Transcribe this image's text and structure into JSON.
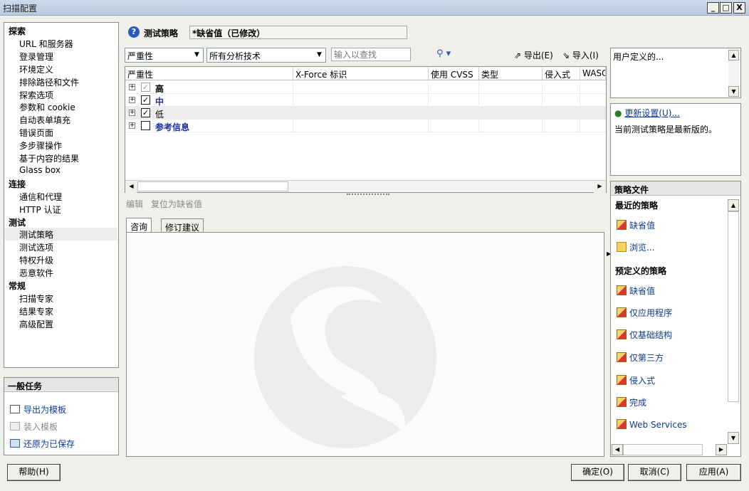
{
  "window": {
    "title": "扫描配置",
    "min_label": "_",
    "max_label": "□",
    "close_label": "X"
  },
  "nav": {
    "groups": [
      {
        "label": "探索",
        "items": [
          "URL 和服务器",
          "登录管理",
          "环境定义",
          "排除路径和文件",
          "探索选项",
          "参数和 cookie",
          "自动表单填充",
          "错误页面",
          "多步骤操作",
          "基于内容的结果",
          "Glass box"
        ]
      },
      {
        "label": "连接",
        "items": [
          "通信和代理",
          "HTTP 认证"
        ]
      },
      {
        "label": "测试",
        "items": [
          "测试策略",
          "测试选项",
          "特权升级",
          "恶意软件"
        ]
      },
      {
        "label": "常规",
        "items": [
          "扫描专家",
          "结果专家",
          "高级配置"
        ]
      }
    ],
    "selected": "测试策略"
  },
  "tasks": {
    "header": "一般任务",
    "items": [
      {
        "label": "导出为模板",
        "enabled": true
      },
      {
        "label": "装入模板",
        "enabled": false
      },
      {
        "label": "还原为已保存",
        "enabled": true
      }
    ]
  },
  "policy": {
    "heading": "测试策略",
    "name_value": "*缺省值（已修改）",
    "help_icon": "?"
  },
  "filters": {
    "severity_select": "严重性",
    "technique_select": "所有分析技术",
    "search_placeholder": "输入以查找",
    "export_label": "导出(E)",
    "import_label": "导入(I)"
  },
  "grid": {
    "columns": [
      "严重性",
      "X-Force 标识",
      "使用 CVSS",
      "类型",
      "侵入式",
      "WASC"
    ],
    "rows": [
      {
        "label": "高",
        "checked": true,
        "dimmed": true,
        "color": "#000000"
      },
      {
        "label": "中",
        "checked": true,
        "dimmed": false,
        "color": "#1b2f9c"
      },
      {
        "label": "低",
        "checked": true,
        "dimmed": false,
        "color": "#000000"
      },
      {
        "label": "参考信息",
        "checked": false,
        "dimmed": false,
        "color": "#1b2f9c"
      }
    ]
  },
  "detail": {
    "edit_label": "编辑",
    "reset_label": "复位为缺省值",
    "tabs": [
      "咨询",
      "修订建议"
    ]
  },
  "right": {
    "user_defined": "用户定义的...",
    "update_link": "更新设置(U)...",
    "update_status": "当前测试策略是最新版的。",
    "policy_files_header": "策略文件",
    "recent_header": "最近的策略",
    "recent_items": [
      "缺省值",
      "浏览..."
    ],
    "predefined_header": "预定义的策略",
    "predefined_items": [
      "缺省值",
      "仅应用程序",
      "仅基础结构",
      "仅第三方",
      "侵入式",
      "完成",
      "Web Services"
    ]
  },
  "buttons": {
    "help": "帮助(H)",
    "ok": "确定(O)",
    "cancel": "取消(C)",
    "apply": "应用(A)"
  }
}
